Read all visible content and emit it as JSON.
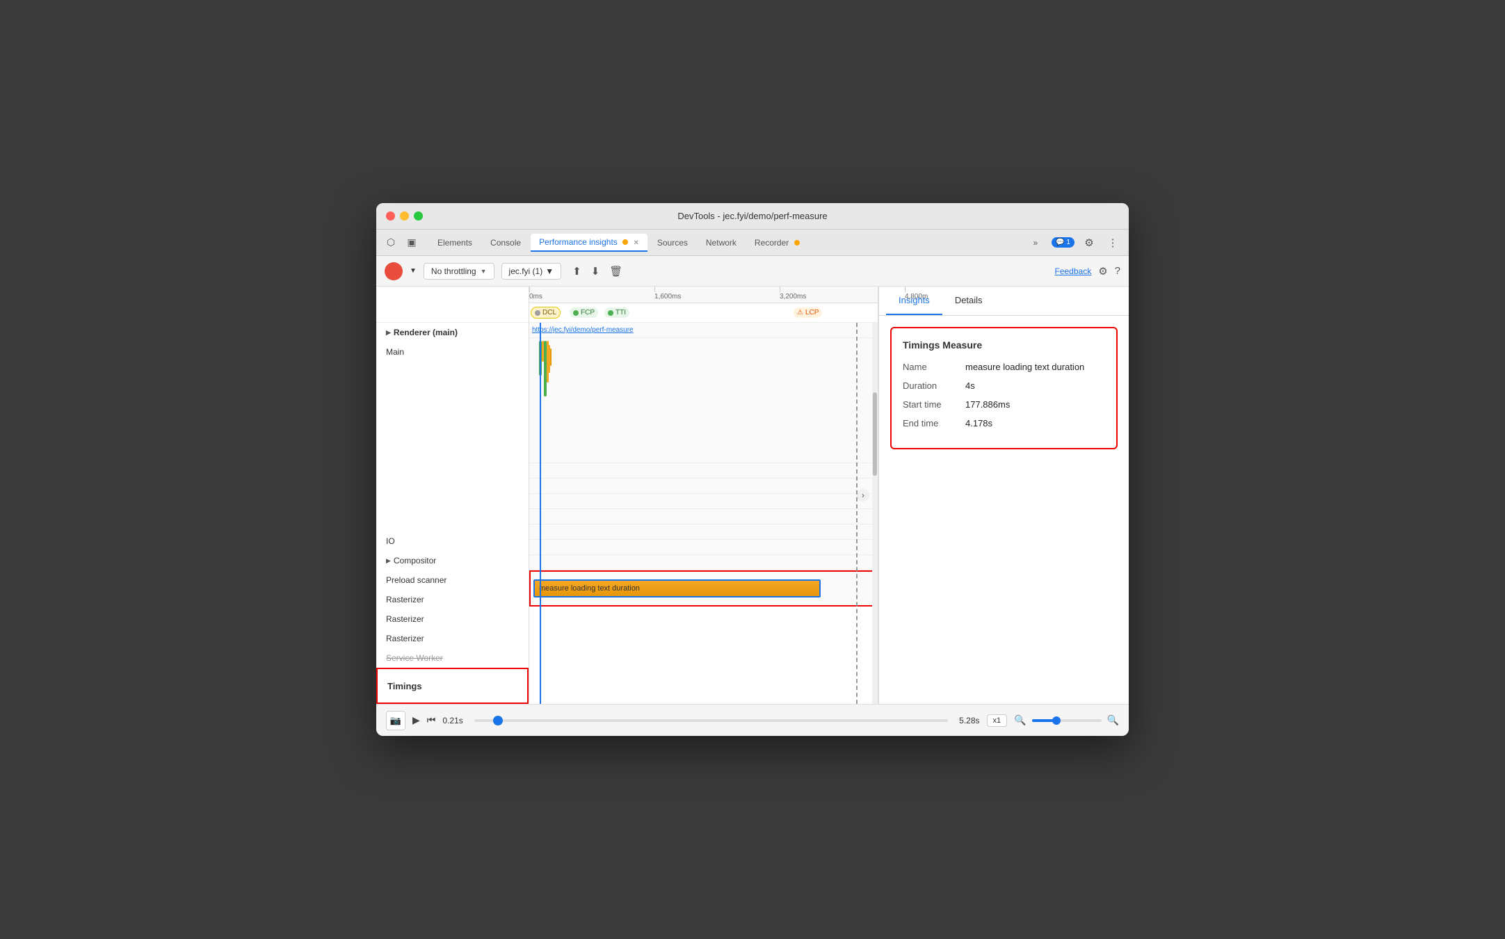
{
  "window": {
    "title": "DevTools - jec.fyi/demo/perf-measure"
  },
  "tabs": [
    {
      "id": "elements",
      "label": "Elements",
      "active": false
    },
    {
      "id": "console",
      "label": "Console",
      "active": false
    },
    {
      "id": "performance-insights",
      "label": "Performance insights",
      "active": true
    },
    {
      "id": "sources",
      "label": "Sources",
      "active": false
    },
    {
      "id": "network",
      "label": "Network",
      "active": false
    },
    {
      "id": "recorder",
      "label": "Recorder",
      "active": false
    }
  ],
  "toolbar": {
    "throttling": "No throttling",
    "url": "jec.fyi (1)",
    "feedback_label": "Feedback"
  },
  "ruler": {
    "marks": [
      "0ms",
      "1,600ms",
      "3,200ms",
      "4,800m"
    ]
  },
  "milestones": {
    "dcl": "DCL",
    "fcp": "FCP",
    "tti": "TTI",
    "lcp": "LCP"
  },
  "tracks": {
    "renderer": "Renderer (main)",
    "main": "Main",
    "io": "IO",
    "compositor": "Compositor",
    "preload_scanner": "Preload scanner",
    "rasterizer1": "Rasterizer",
    "rasterizer2": "Rasterizer",
    "rasterizer3": "Rasterizer",
    "service_worker": "Service Worker",
    "timings": "Timings"
  },
  "url_track": "https://jec.fyi/demo/perf-measure",
  "timing_bar": {
    "label": "measure loading text duration"
  },
  "insights": {
    "tab_insights": "Insights",
    "tab_details": "Details",
    "card_title": "Timings Measure",
    "name_label": "Name",
    "name_value": "measure loading text duration",
    "duration_label": "Duration",
    "duration_value": "4s",
    "start_time_label": "Start time",
    "start_time_value": "177.886ms",
    "end_time_label": "End time",
    "end_time_value": "4.178s"
  },
  "bottom": {
    "time_start": "0.21s",
    "time_end": "5.28s",
    "zoom": "x1"
  }
}
